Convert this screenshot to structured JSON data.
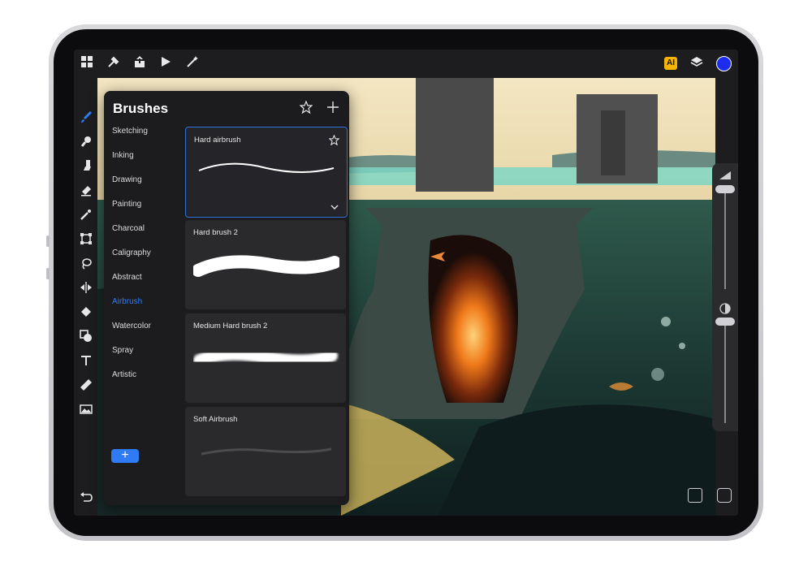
{
  "topbar": {
    "left_icons": [
      "gallery-icon",
      "wrench-icon",
      "share-icon",
      "play-icon",
      "magic-wand-icon"
    ],
    "ai_badge": "AI",
    "right_icons": [
      "layers-icon",
      "color-swatch-icon"
    ],
    "accent_color": "#1d2df0"
  },
  "tools": [
    "brush-icon",
    "smudge-icon",
    "paint-brush-icon",
    "eraser-icon",
    "adjustments-icon",
    "transform-icon",
    "lasso-icon",
    "symmetry-icon",
    "fill-icon",
    "shapes-icon",
    "text-icon",
    "ruler-icon",
    "image-icon",
    "undo-icon"
  ],
  "brushes_panel": {
    "title": "Brushes",
    "categories": [
      "Sketching",
      "Inking",
      "Drawing",
      "Painting",
      "Charcoal",
      "Caligraphy",
      "Abstract",
      "Airbrush",
      "Watercolor",
      "Spray",
      "Artistic"
    ],
    "active_category": "Airbrush",
    "active_color": "#2f7bf5",
    "add_label": "+",
    "brushes": [
      {
        "name": "Hard airbrush",
        "selected": true
      },
      {
        "name": "Hard brush 2",
        "selected": false
      },
      {
        "name": "Medium Hard brush 2",
        "selected": false
      },
      {
        "name": "Soft Airbrush",
        "selected": false
      }
    ]
  },
  "sidebar_right": {
    "size_level": 0.93,
    "opacity_level": 0.6
  }
}
